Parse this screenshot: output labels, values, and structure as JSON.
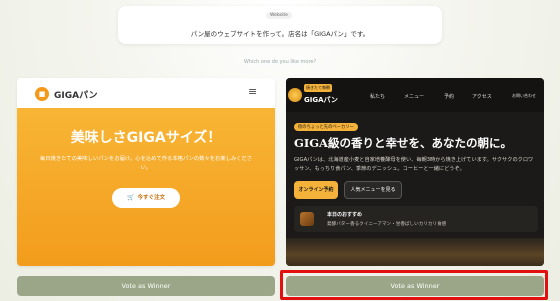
{
  "prompt": {
    "badge": "Website",
    "text": "パン屋のウェブサイトを作って。店名は「GIGAパン」です。"
  },
  "question": "Which one do you like more?",
  "panel_a": {
    "logo_icon": "bread-icon",
    "brand": "GIGAパン",
    "menu_icon": "hamburger-icon",
    "title": "美味しさGIGAサイズ！",
    "subtitle": "毎日焼きたての美味しいパンをお届け。心を込めて作る本格パンの数々をお楽しみください。",
    "button_label": "今すぐ注文",
    "colors": {
      "accent": "#f39c1c",
      "hero_top": "#f8b535"
    }
  },
  "panel_b": {
    "tag": "焼きたて毎朝",
    "brand": "GIGAパン",
    "nav": [
      "私たち",
      "メニュー",
      "予約",
      "アクセス",
      "お問い合わせ"
    ],
    "eyebrow": "街のちょっと先のベーカリー",
    "title": "GIGA級の香りと幸せを、あなたの朝に。",
    "description": "GIGAパンは、北海道産小麦と自家培養酵母を使い、毎朝3時から焼き上げています。サクサクのクロワッサン、もっちり食パン、季節のデニッシュ。コーヒーと一緒にどうぞ。",
    "primary_button": "オンライン予約",
    "secondary_button": "人気メニューを見る",
    "card_title": "本日のおすすめ",
    "card_text": "発酵バター香るクイニーアマン・甘香ばしいカリカリ食感",
    "colors": {
      "accent": "#f4b23a",
      "background": "#1b1a19"
    }
  },
  "votes": {
    "a_label": "Vote as Winner",
    "b_label": "Vote as Winner"
  }
}
